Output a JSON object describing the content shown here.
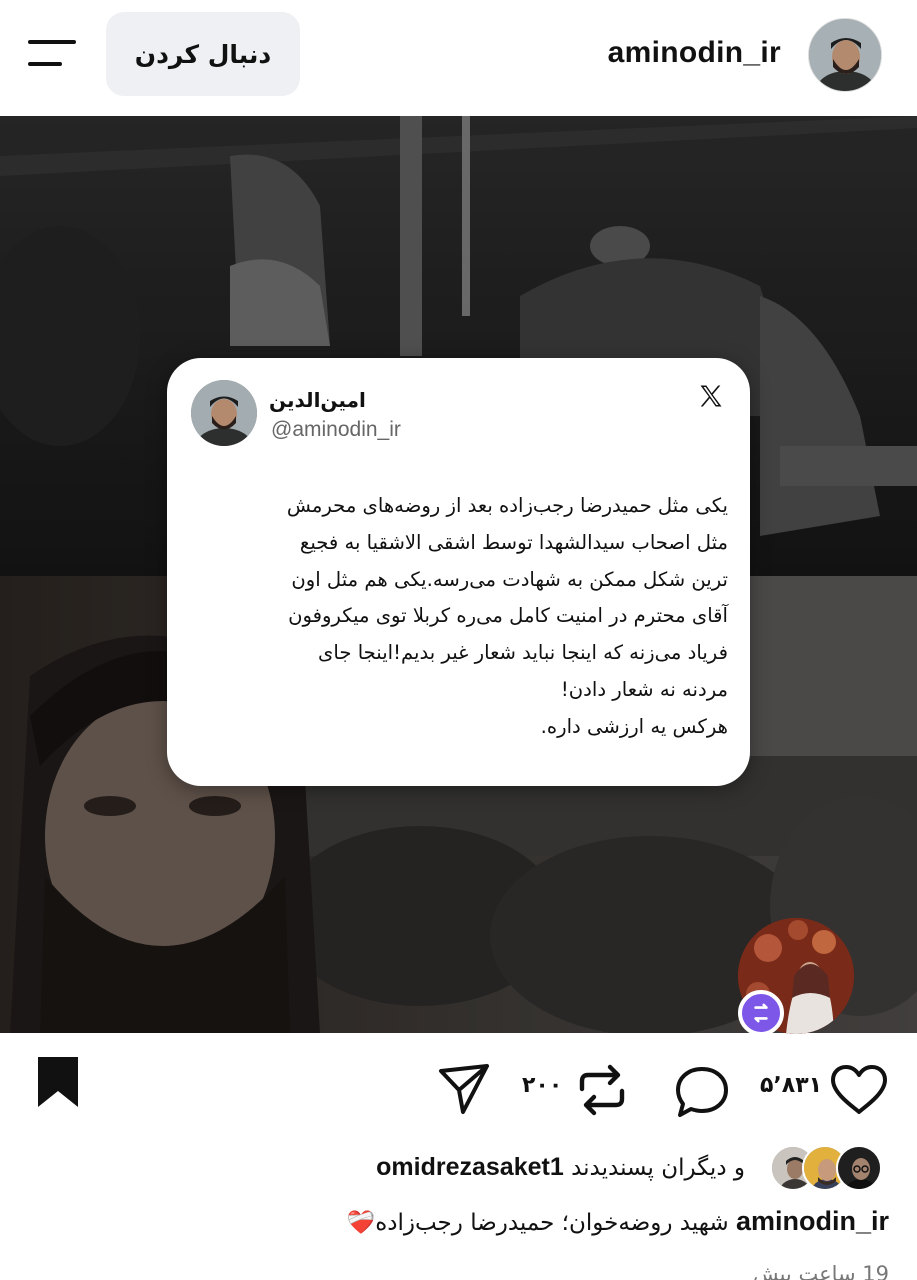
{
  "header": {
    "username": "aminodin_ir",
    "follow_label": "دنبال کردن"
  },
  "tweet": {
    "name": "امین‌الدین",
    "handle": "@aminodin_ir",
    "text": "یکی مثل حمیدرضا رجب‌زاده بعد از روضه‌های محرمش\nمثل اصحاب سیدالشهدا توسط اشقی الاشقیا به فجیع\nترین شکل ممکن به شهادت می‌رسه.یکی هم مثل اون\nآقای محترم در امنیت کامل می‌ره کربلا توی میکروفون\nفریاد می‌زنه که اینجا نباید شعار غیر بدیم!اینجا جای\nمردنه نه شعار دادن!\nهرکس یه ارزشی داره."
  },
  "actions": {
    "likes_count": "۵٬۸۳۱",
    "reposts_count": "۲۰۰"
  },
  "likes": {
    "liked_by": "omidrezasaket1",
    "suffix": "و دیگران پسندیدند"
  },
  "caption": {
    "author": "aminodin_ir",
    "text": "شهید روضه‌خوان؛ حمیدرضا رجب‌زاده",
    "emoji": "❤️‍🩹"
  },
  "time": "19 ساعت پیش",
  "icons": [
    "menu-icon",
    "heart-icon",
    "comment-icon",
    "repost-icon",
    "share-icon",
    "bookmark-icon",
    "x-logo-icon",
    "repost-badge-icon"
  ]
}
